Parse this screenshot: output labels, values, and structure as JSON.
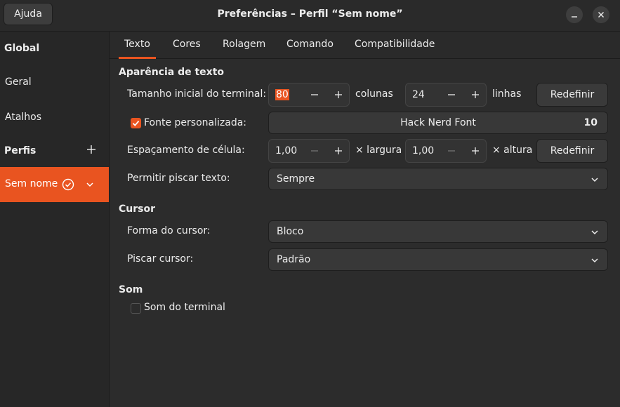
{
  "window": {
    "title": "Preferências – Perfil “Sem nome”",
    "help_label": "Ajuda",
    "accent": "#e95420"
  },
  "sidebar": {
    "global_heading": "Global",
    "general_label": "Geral",
    "shortcuts_label": "Atalhos",
    "profiles_heading": "Perfis",
    "active_profile": "Sem nome"
  },
  "tabs": [
    "Texto",
    "Cores",
    "Rolagem",
    "Comando",
    "Compatibilidade"
  ],
  "text_appearance": {
    "heading": "Aparência de texto",
    "size_label": "Tamanho inicial do terminal:",
    "columns_value": "80",
    "columns_unit": "colunas",
    "rows_value": "24",
    "rows_unit": "linhas",
    "reset_label": "Redefinir",
    "custom_font_label": "Fonte personalizada:",
    "custom_font_checked": true,
    "font_name": "Hack Nerd Font",
    "font_size": "10",
    "spacing_label": "Espaçamento de célula:",
    "width_value": "1,00",
    "width_unit": "× largura",
    "height_value": "1,00",
    "height_unit": "× altura",
    "blink_label": "Permitir piscar texto:",
    "blink_value": "Sempre"
  },
  "cursor": {
    "heading": "Cursor",
    "shape_label": "Forma do cursor:",
    "shape_value": "Bloco",
    "blink_label": "Piscar cursor:",
    "blink_value": "Padrão"
  },
  "sound": {
    "heading": "Som",
    "bell_label": "Som do terminal",
    "bell_checked": false
  }
}
